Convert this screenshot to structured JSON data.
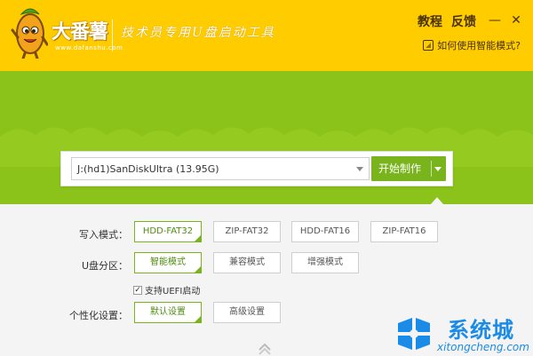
{
  "header": {
    "brand_name": "大番薯",
    "brand_url": "www.dafanshu.com",
    "slogan": "技术员专用U盘启动工具",
    "nav": [
      "教程",
      "反馈"
    ],
    "help_link": "如何使用智能模式?",
    "colors": {
      "header_bg": "#ffcc00",
      "green": "#8bc31a",
      "accent": "#79b41c"
    }
  },
  "device": {
    "selected": "J:(hd1)SanDiskUltra (13.95G)",
    "start_label": "开始制作"
  },
  "options": {
    "write_mode": {
      "label": "写入模式：",
      "items": [
        "HDD-FAT32",
        "ZIP-FAT32",
        "HDD-FAT16",
        "ZIP-FAT16"
      ],
      "selected": "HDD-FAT32"
    },
    "partition": {
      "label": "U盘分区：",
      "items": [
        "智能模式",
        "兼容模式",
        "增强模式"
      ],
      "selected": "智能模式"
    },
    "uefi": {
      "label": "支持UEFI启动",
      "checked": true
    },
    "personalize": {
      "label": "个性化设置：",
      "items": [
        "默认设置",
        "高级设置"
      ],
      "selected": "默认设置"
    }
  },
  "watermark": {
    "title": "系统城",
    "subtitle": "xitongcheng.com"
  }
}
